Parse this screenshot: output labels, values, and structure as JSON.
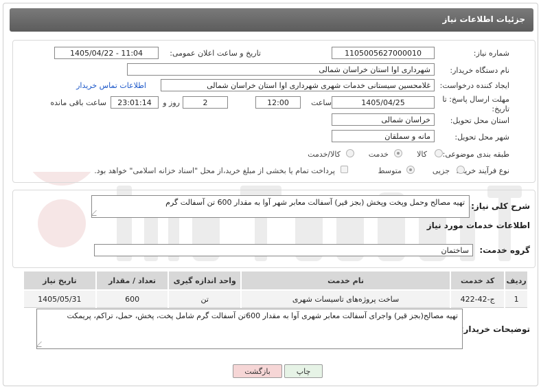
{
  "header": {
    "title": "جزئیات اطلاعات نیاز"
  },
  "fields": {
    "need_number_label": "شماره نیاز:",
    "need_number": "1105005627000010",
    "announce_label": "تاریخ و ساعت اعلان عمومی:",
    "announce_value": "1405/04/22 - 11:04",
    "buyer_org_label": "نام دستگاه خریدار:",
    "buyer_org": "شهرداری اوا استان خراسان شمالی",
    "requester_label": "ایجاد کننده درخواست:",
    "requester": "غلامحسین  سیستانی  خدمات شهری شهرداری اوا استان خراسان شمالی",
    "contact_link": "اطلاعات تماس خریدار",
    "deadline_label_1": "مهلت ارسال پاسخ: تا",
    "deadline_label_2": "تاریخ:",
    "deadline_date": "1405/04/25",
    "time_label": "ساعت",
    "deadline_time": "12:00",
    "days_value": "2",
    "days_label": "روز و",
    "remaining_time": "23:01:14",
    "remaining_label": "ساعت باقی مانده",
    "province_label": "استان محل تحویل:",
    "province": "خراسان شمالی",
    "city_label": "شهر محل تحویل:",
    "city": "مانه و سملقان",
    "category_label": "طبقه بندی موضوعی:",
    "category_options": {
      "goods": "کالا",
      "service": "خدمت",
      "goods_service": "کالا/خدمت"
    },
    "process_label": "نوع فرآیند خرید :",
    "process_options": {
      "partial": "جزیی",
      "medium": "متوسط"
    },
    "payment_note": "پرداخت تمام یا بخشی از مبلغ خرید،از محل \"اسناد خزانه اسلامی\" خواهد بود."
  },
  "summary": {
    "label": "شرح کلی نیاز:",
    "text": "تهیه مصالح وحمل وپخت وپخش (بجز قیر) آسفالت معابر شهر آوا به مقدار 600 تن آسفالت گرم"
  },
  "services_info": {
    "title": "اطلاعات خدمات مورد نیاز",
    "group_label": "گروه خدمت:",
    "group_value": "ساختمان"
  },
  "table": {
    "headers": [
      "ردیف",
      "کد خدمت",
      "نام خدمت",
      "واحد اندازه گیری",
      "تعداد / مقدار",
      "تاریخ نیاز"
    ],
    "rows": [
      [
        "1",
        "ج-42-422",
        "ساخت پروژه‌های تاسیسات شهری",
        "تن",
        "600",
        "1405/05/31"
      ]
    ]
  },
  "buyer_notes": {
    "label": "توضیحات خریدار:",
    "text": "تهیه مصالح(بجز قیر) واجرای آسفالت معابر شهری آوا به مقدار 600تن آسفالت گرم شامل پخت، پخش، حمل، تراکم، پریمکت"
  },
  "buttons": {
    "print": "چاپ",
    "back": "بازگشت"
  },
  "colors": {
    "header_bg": "#6b6b6b",
    "link": "#1a56c8",
    "back_btn": "#f6d6d6",
    "print_btn": "#e6f3e6"
  }
}
